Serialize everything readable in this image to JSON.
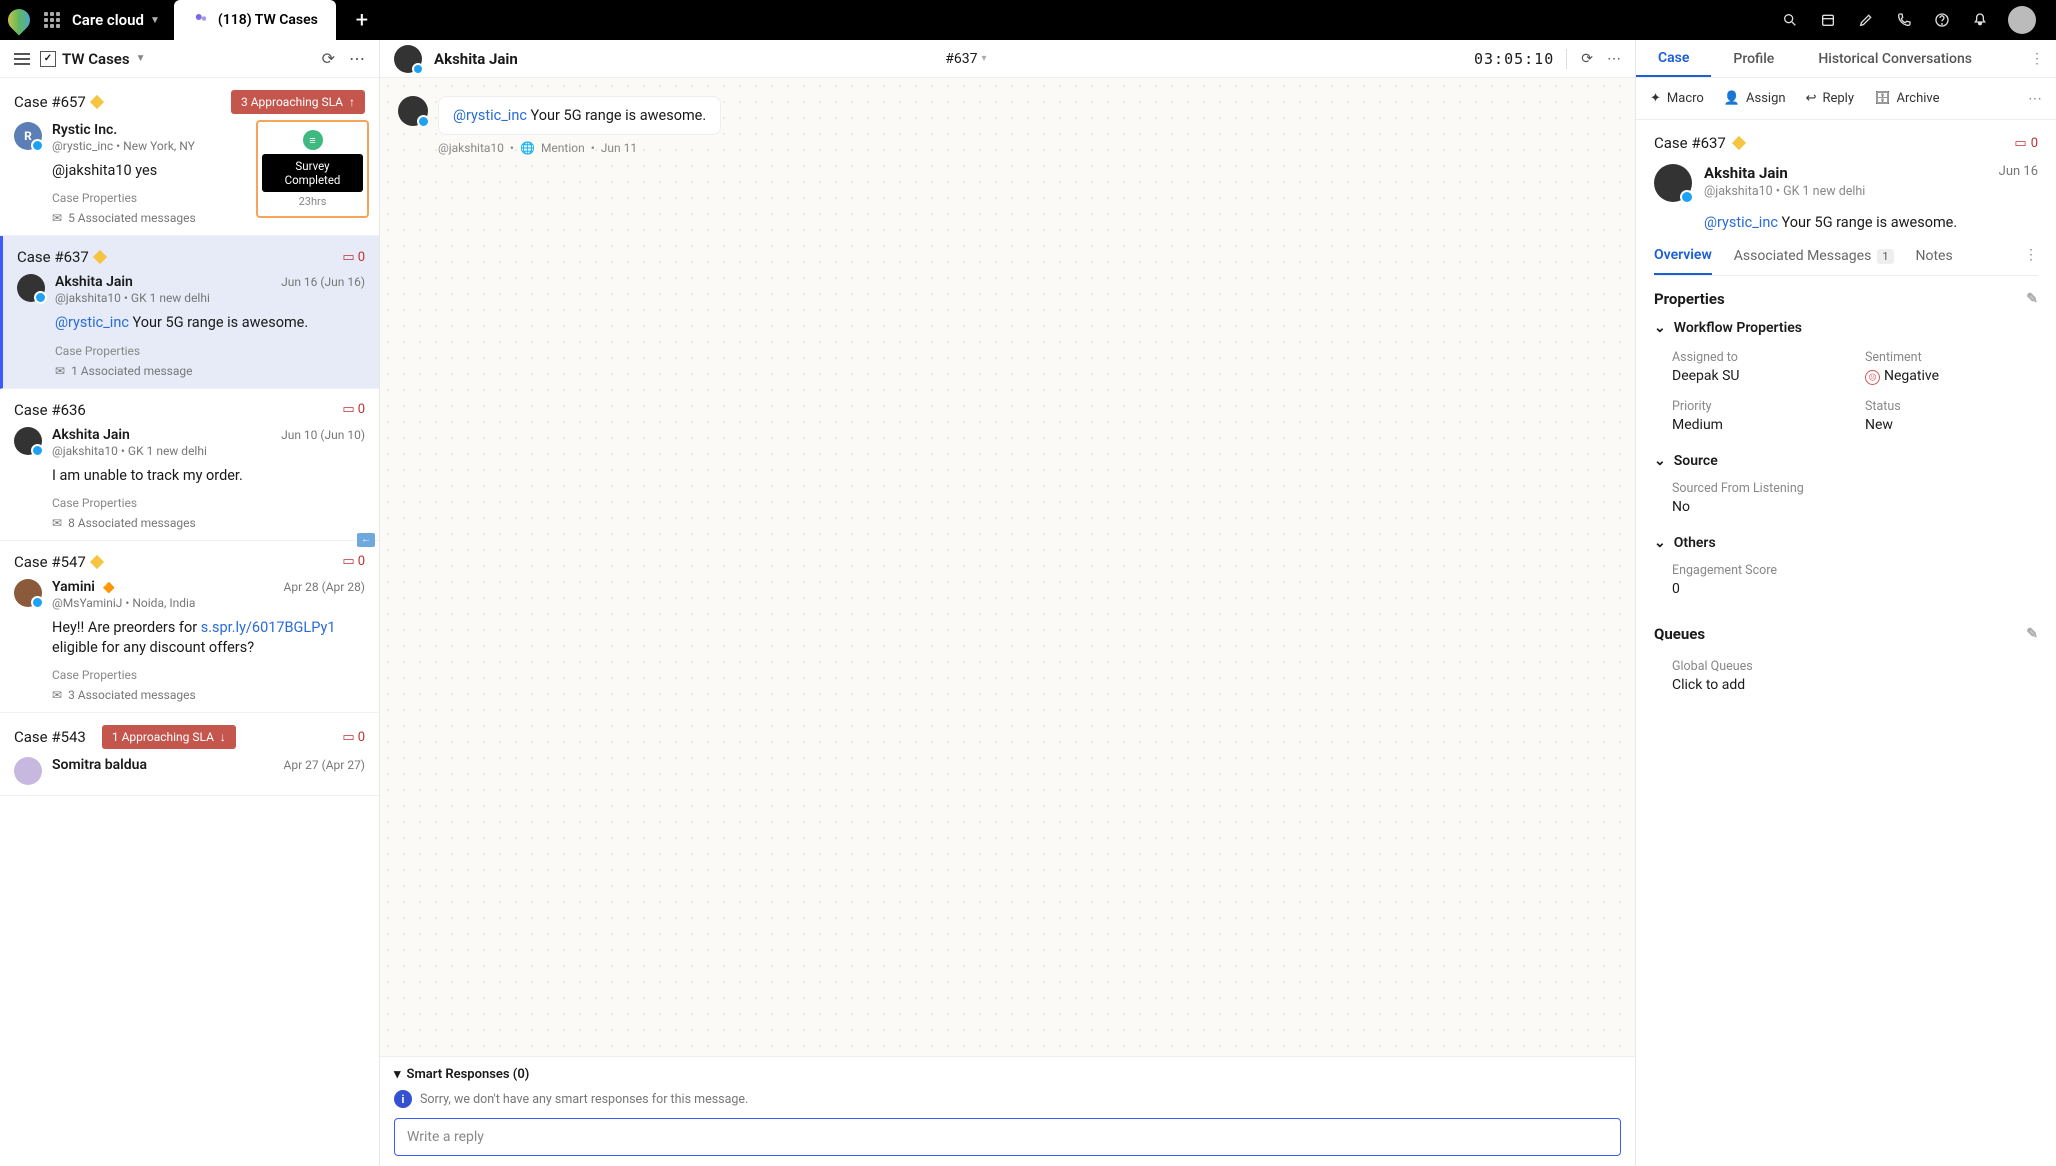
{
  "topbar": {
    "workspace": "Care cloud",
    "tab_title": "(118) TW Cases"
  },
  "list": {
    "title": "TW Cases"
  },
  "survey": {
    "tooltip": "Survey Completed",
    "time": "23hrs"
  },
  "cases": [
    {
      "id": "Case #657",
      "sla": "3 Approaching SLA",
      "user": "Rystic Inc.",
      "handle": "@rystic_inc  •  New York, NY",
      "msg_pre": "@jakshita10",
      "msg": " yes",
      "props": "Case Properties",
      "assoc": "5 Associated messages"
    },
    {
      "id": "Case #637",
      "count": "0",
      "user": "Akshita Jain",
      "dates": "Jun 16  (Jun 16)",
      "handle": "@jakshita10  •  GK 1 new delhi",
      "msg_mention": "@rystic_inc",
      "msg": " Your 5G range is awesome.",
      "props": "Case Properties",
      "assoc": "1 Associated message"
    },
    {
      "id": "Case #636",
      "count": "0",
      "user": "Akshita Jain",
      "dates": "Jun 10  (Jun 10)",
      "handle": "@jakshita10  •  GK 1 new delhi",
      "msg": "I am unable to track my order.",
      "props": "Case Properties",
      "assoc": "8 Associated messages"
    },
    {
      "id": "Case #547",
      "count": "0",
      "user": "Yamini",
      "dates": "Apr 28  (Apr 28)",
      "handle": "@MsYaminiJ  •  Noida, India",
      "msg_pre": "Hey!! Are preorders for ",
      "msg_link": "s.spr.ly/6017BGLPy1",
      "msg_post": " eligible for any discount offers?",
      "props": "Case Properties",
      "assoc": "3 Associated messages"
    },
    {
      "id": "Case #543",
      "sla": "1 Approaching SLA",
      "count": "0",
      "user": "Somitra baldua",
      "dates": "Apr 27  (Apr 27)"
    }
  ],
  "convo": {
    "name": "Akshita Jain",
    "case_id": "#637",
    "timer": "03:05:10",
    "msg_mention": "@rystic_inc",
    "msg": " Your 5G range is awesome.",
    "meta_handle": "@jakshita10",
    "meta_type": "Mention",
    "meta_date": "Jun 11",
    "smart_title": "Smart Responses (0)",
    "smart_msg": "Sorry, we don't have any smart responses for this message.",
    "reply_placeholder": "Write a reply"
  },
  "detail": {
    "tabs": {
      "case": "Case",
      "profile": "Profile",
      "historical": "Historical Conversations"
    },
    "actions": {
      "macro": "Macro",
      "assign": "Assign",
      "reply": "Reply",
      "archive": "Archive"
    },
    "case_id": "Case #637",
    "count": "0",
    "user": {
      "name": "Akshita Jain",
      "handle": "@jakshita10  •  GK 1 new delhi",
      "date": "Jun 16"
    },
    "msg_mention": "@rystic_inc",
    "msg": " Your 5G range is awesome.",
    "subtabs": {
      "overview": "Overview",
      "assoc": "Associated Messages",
      "assoc_count": "1",
      "notes": "Notes"
    },
    "section_properties": "Properties",
    "workflow_title": "Workflow Properties",
    "workflow": {
      "assigned_label": "Assigned to",
      "assigned": "Deepak SU",
      "sentiment_label": "Sentiment",
      "sentiment": "Negative",
      "priority_label": "Priority",
      "priority": "Medium",
      "status_label": "Status",
      "status": "New"
    },
    "source_title": "Source",
    "source": {
      "label": "Sourced From Listening",
      "value": "No"
    },
    "others_title": "Others",
    "others": {
      "label": "Engagement Score",
      "value": "0"
    },
    "queues_title": "Queues",
    "queues": {
      "label": "Global Queues",
      "value": "Click to add"
    }
  }
}
